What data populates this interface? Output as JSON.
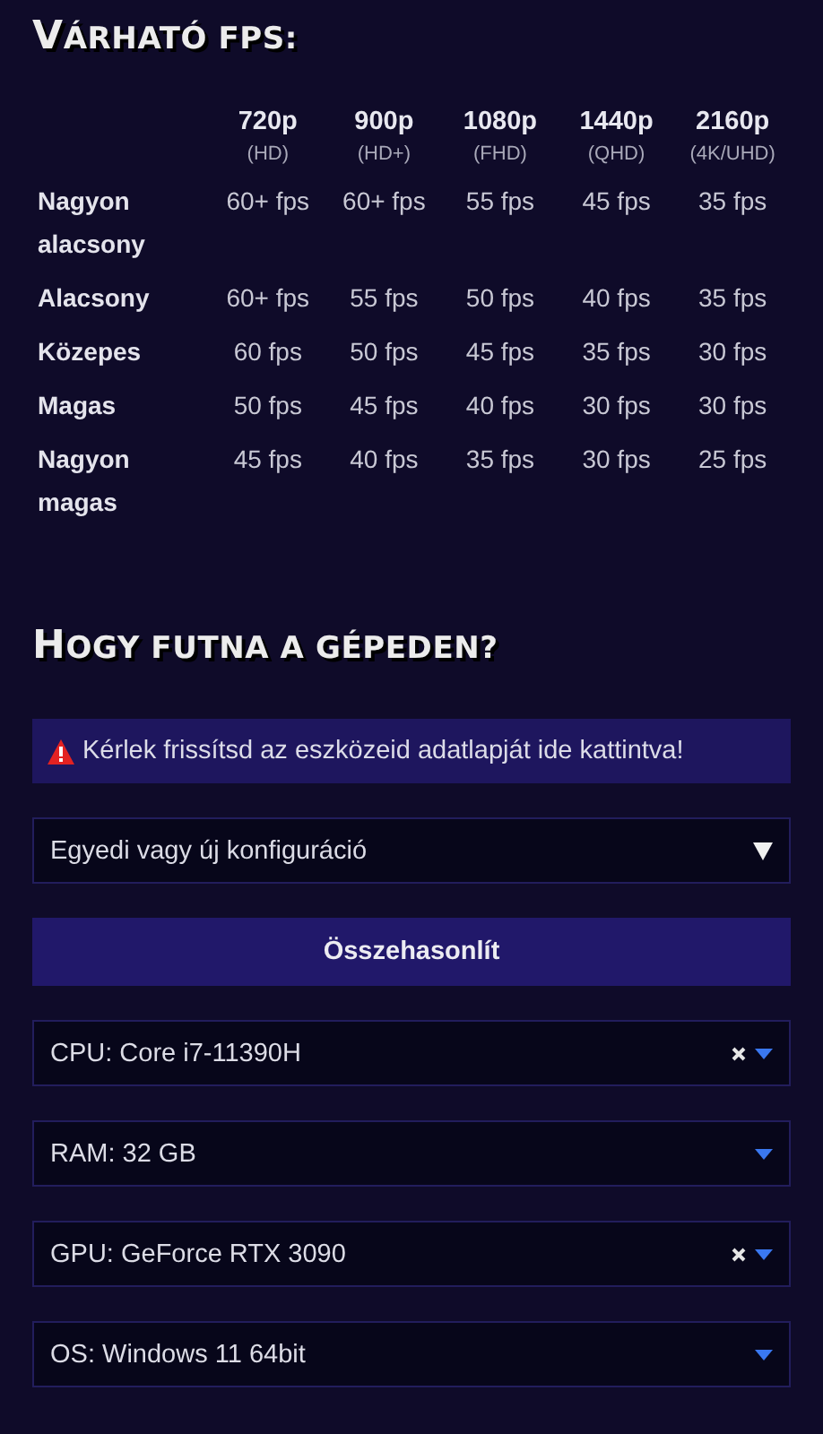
{
  "fps_section": {
    "title": "VÁRHATÓ FPS:",
    "table": {
      "columns": [
        {
          "resolution": "720p",
          "name": "(HD)"
        },
        {
          "resolution": "900p",
          "name": "(HD+)"
        },
        {
          "resolution": "1080p",
          "name": "(FHD)"
        },
        {
          "resolution": "1440p",
          "name": "(QHD)"
        },
        {
          "resolution": "2160p",
          "name": "(4K/UHD)"
        }
      ],
      "rows": [
        {
          "label": "Nagyon alacsony",
          "cells": [
            "60+ fps",
            "60+ fps",
            "55 fps",
            "45 fps",
            "35 fps"
          ]
        },
        {
          "label": "Alacsony",
          "cells": [
            "60+ fps",
            "55 fps",
            "50 fps",
            "40 fps",
            "35 fps"
          ]
        },
        {
          "label": "Közepes",
          "cells": [
            "60 fps",
            "50 fps",
            "45 fps",
            "35 fps",
            "30 fps"
          ]
        },
        {
          "label": "Magas",
          "cells": [
            "50 fps",
            "45 fps",
            "40 fps",
            "30 fps",
            "30 fps"
          ]
        },
        {
          "label": "Nagyon magas",
          "cells": [
            "45 fps",
            "40 fps",
            "35 fps",
            "30 fps",
            "25 fps"
          ]
        }
      ]
    }
  },
  "compare_section": {
    "title": "HOGY FUTNA A GÉPEDEN?",
    "alert": "Kérlek frissítsd az eszközeid adatlapját ide kattintva!",
    "fields": [
      {
        "kind": "select",
        "value": "Egyedi vagy új konfiguráció"
      },
      {
        "kind": "button",
        "value": "Összehasonlít"
      },
      {
        "kind": "combo",
        "value": "CPU: Core i7-11390H",
        "clearable": true
      },
      {
        "kind": "combo",
        "value": "RAM: 32 GB",
        "clearable": false
      },
      {
        "kind": "combo",
        "value": "GPU: GeForce RTX 3090",
        "clearable": true
      },
      {
        "kind": "combo",
        "value": "OS: Windows 11 64bit",
        "clearable": false
      }
    ]
  }
}
